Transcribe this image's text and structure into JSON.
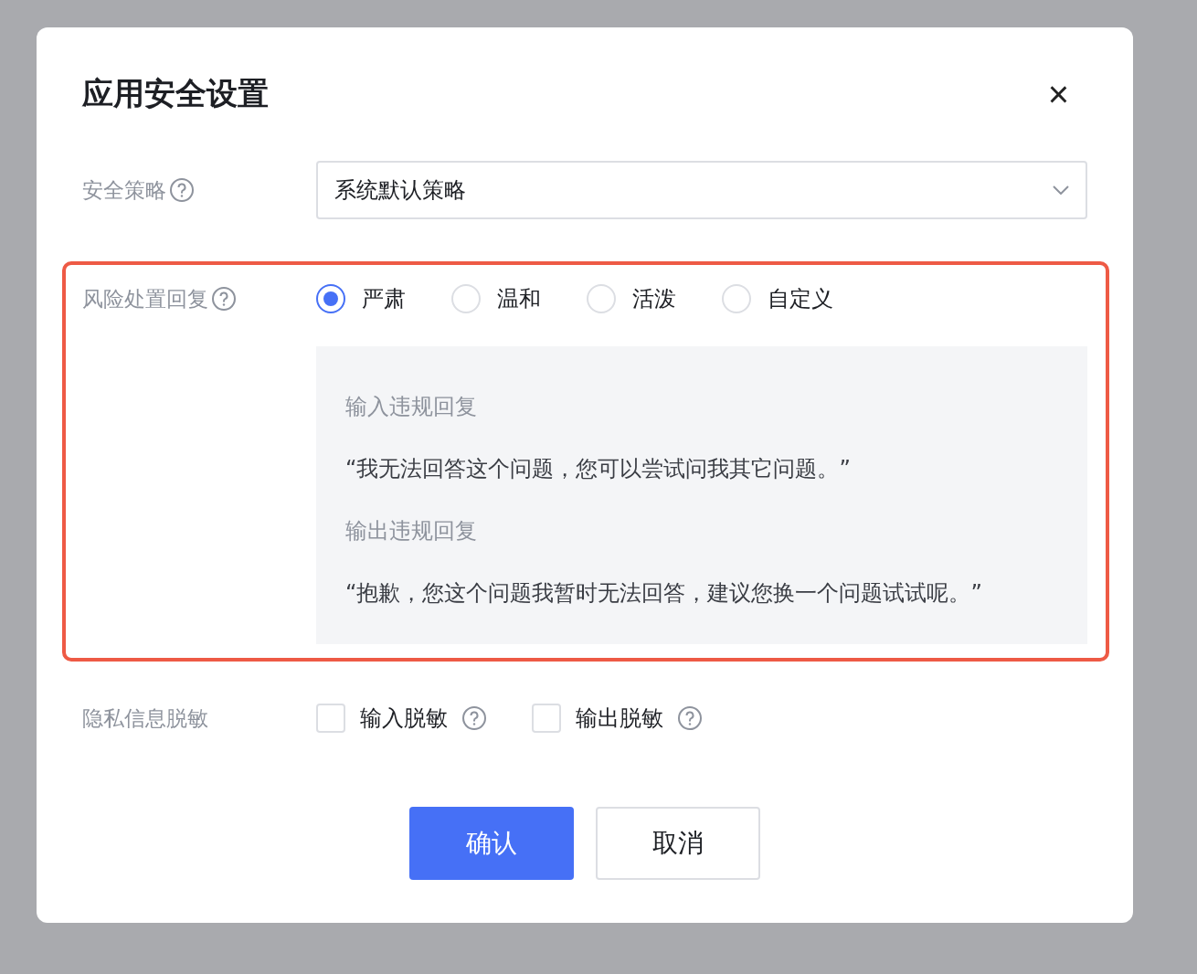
{
  "dialog": {
    "title": "应用安全设置",
    "close_icon": "×"
  },
  "policy": {
    "label": "安全策略",
    "value": "系统默认策略"
  },
  "risk_reply": {
    "label": "风险处置回复",
    "highlighted": true,
    "options": [
      {
        "label": "严肃",
        "selected": true
      },
      {
        "label": "温和",
        "selected": false
      },
      {
        "label": "活泼",
        "selected": false
      },
      {
        "label": "自定义",
        "selected": false
      }
    ],
    "preview": [
      {
        "kind": "heading",
        "text": "输入违规回复"
      },
      {
        "kind": "body",
        "text": "“我无法回答这个问题，您可以尝试问我其它问题。”"
      },
      {
        "kind": "heading",
        "text": "输出违规回复"
      },
      {
        "kind": "body",
        "text": "“抱歉，您这个问题我暂时无法回答，建议您换一个问题试试呢。”"
      }
    ]
  },
  "privacy": {
    "label": "隐私信息脱敏",
    "options": [
      {
        "label": "输入脱敏",
        "checked": false
      },
      {
        "label": "输出脱敏",
        "checked": false
      }
    ]
  },
  "buttons": [
    {
      "label": "确认",
      "kind": "primary"
    },
    {
      "label": "取消",
      "kind": "secondary"
    }
  ]
}
